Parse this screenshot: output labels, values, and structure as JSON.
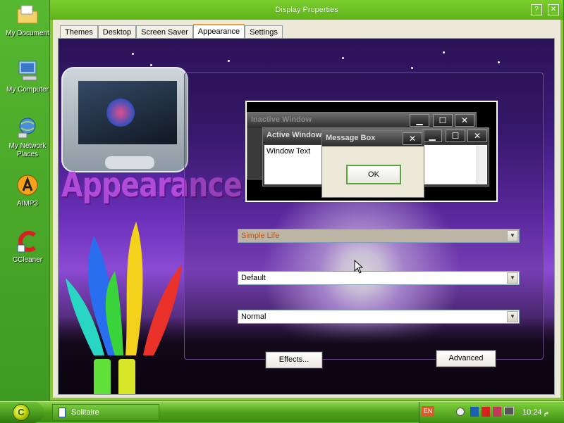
{
  "desktop": {
    "icons": [
      {
        "label": "My Document",
        "icon": "folder-icon"
      },
      {
        "label": "My Computer",
        "icon": "computer-icon"
      },
      {
        "label": "My Network Places",
        "icon": "network-icon"
      },
      {
        "label": "AIMP3",
        "icon": "aimp-icon"
      },
      {
        "label": "CCleaner",
        "icon": "ccleaner-icon"
      }
    ]
  },
  "window": {
    "title": "Display Properties",
    "help_label": "?",
    "close_label": "✕",
    "tabs": [
      {
        "label": "Themes",
        "active": false
      },
      {
        "label": "Desktop",
        "active": false
      },
      {
        "label": "Screen Saver",
        "active": false
      },
      {
        "label": "Appearance",
        "active": true
      },
      {
        "label": "Settings",
        "active": false
      }
    ],
    "banner": {
      "heading": "Appearance"
    },
    "preview": {
      "inactive_title": "Inactive Window",
      "active_title": "Active Window",
      "window_text": "Window Text",
      "message_title": "Message Box",
      "ok_label": "OK",
      "minimize_glyph": "▁",
      "maximize_glyph": "☐",
      "close_glyph": "✕"
    },
    "combos": [
      {
        "value": "Simple Life"
      },
      {
        "value": "Default"
      },
      {
        "value": "Normal"
      }
    ],
    "effects_label": "Effects...",
    "advanced_label": "Advanced"
  },
  "taskbar": {
    "start_glyph": "C",
    "task_label": "Solitaire",
    "lang": "EN",
    "clock": "10:24 م"
  },
  "colors": {
    "titlebar": "#5eb31a",
    "heading": "#b14bd9",
    "selected_combo_text": "#b8571a"
  }
}
